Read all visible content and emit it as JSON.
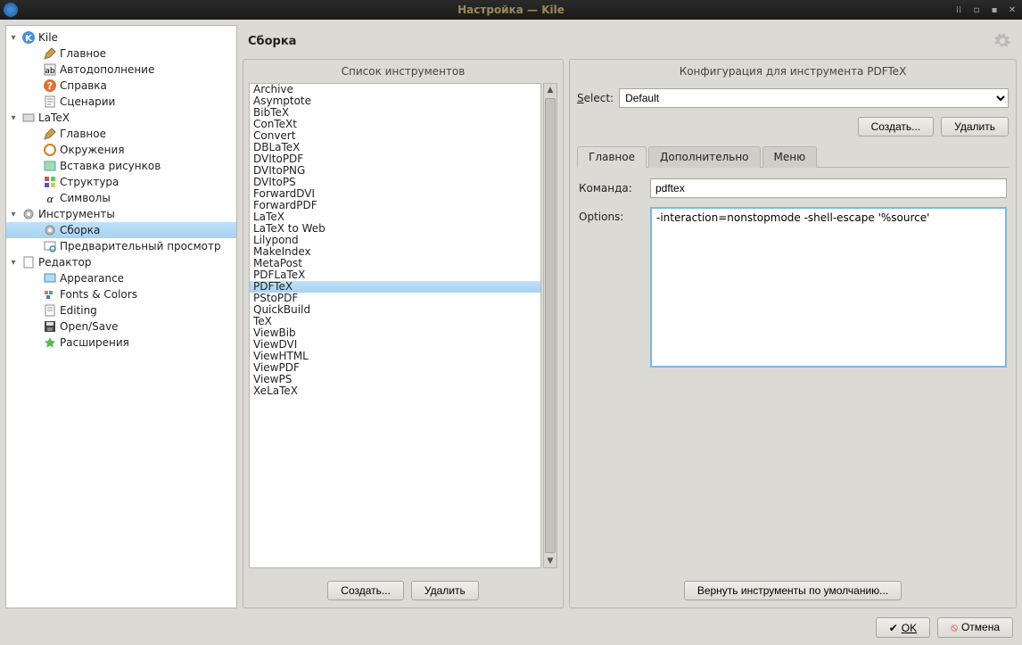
{
  "window": {
    "title": "Настройка — Kile"
  },
  "page": {
    "title": "Сборка"
  },
  "sidebar": {
    "nodes": [
      {
        "label": "Kile",
        "depth": 0,
        "expand": "▾",
        "icon": "app",
        "sel": false
      },
      {
        "label": "Главное",
        "depth": 1,
        "expand": "",
        "icon": "pencil",
        "sel": false
      },
      {
        "label": "Автодополнение",
        "depth": 1,
        "expand": "",
        "icon": "auto",
        "sel": false
      },
      {
        "label": "Справка",
        "depth": 1,
        "expand": "",
        "icon": "help",
        "sel": false
      },
      {
        "label": "Сценарии",
        "depth": 1,
        "expand": "",
        "icon": "script",
        "sel": false
      },
      {
        "label": "LaTeX",
        "depth": 0,
        "expand": "▾",
        "icon": "latex",
        "sel": false
      },
      {
        "label": "Главное",
        "depth": 1,
        "expand": "",
        "icon": "pencil",
        "sel": false
      },
      {
        "label": "Окружения",
        "depth": 1,
        "expand": "",
        "icon": "env",
        "sel": false
      },
      {
        "label": "Вставка рисунков",
        "depth": 1,
        "expand": "",
        "icon": "img",
        "sel": false
      },
      {
        "label": "Структура",
        "depth": 1,
        "expand": "",
        "icon": "struct",
        "sel": false
      },
      {
        "label": "Символы",
        "depth": 1,
        "expand": "",
        "icon": "alpha",
        "sel": false
      },
      {
        "label": "Инструменты",
        "depth": 0,
        "expand": "▾",
        "icon": "gear",
        "sel": false
      },
      {
        "label": "Сборка",
        "depth": 1,
        "expand": "",
        "icon": "gear",
        "sel": true
      },
      {
        "label": "Предварительный просмотр",
        "depth": 1,
        "expand": "",
        "icon": "preview",
        "sel": false
      },
      {
        "label": "Редактор",
        "depth": 0,
        "expand": "▾",
        "icon": "editor",
        "sel": false
      },
      {
        "label": "Appearance",
        "depth": 1,
        "expand": "",
        "icon": "appear",
        "sel": false
      },
      {
        "label": "Fonts & Colors",
        "depth": 1,
        "expand": "",
        "icon": "fonts",
        "sel": false
      },
      {
        "label": "Editing",
        "depth": 1,
        "expand": "",
        "icon": "edit",
        "sel": false
      },
      {
        "label": "Open/Save",
        "depth": 1,
        "expand": "",
        "icon": "save",
        "sel": false
      },
      {
        "label": "Расширения",
        "depth": 1,
        "expand": "",
        "icon": "ext",
        "sel": false
      }
    ]
  },
  "tools": {
    "header": "Список инструментов",
    "items": [
      "Archive",
      "Asymptote",
      "BibTeX",
      "ConTeXt",
      "Convert",
      "DBLaTeX",
      "DVItoPDF",
      "DVItoPNG",
      "DVItoPS",
      "ForwardDVI",
      "ForwardPDF",
      "LaTeX",
      "LaTeX to Web",
      "Lilypond",
      "MakeIndex",
      "MetaPost",
      "PDFLaTeX",
      "PDFTeX",
      "PStoPDF",
      "QuickBuild",
      "TeX",
      "ViewBib",
      "ViewDVI",
      "ViewHTML",
      "ViewPDF",
      "ViewPS",
      "XeLaTeX"
    ],
    "selected": "PDFTeX",
    "create": "Создать...",
    "delete": "Удалить"
  },
  "config": {
    "header": "Конфигурация для инструмента PDFTeX",
    "select_label": "Select:",
    "select_value": "Default",
    "create": "Создать...",
    "delete": "Удалить",
    "tabs": {
      "main": "Главное",
      "advanced": "Дополнительно",
      "menu": "Меню"
    },
    "command_label": "Команда:",
    "command_value": "pdftex",
    "options_label": "Options:",
    "options_value": "-interaction=nonstopmode -shell-escape '%source'",
    "restore": "Вернуть инструменты по умолчанию..."
  },
  "footer": {
    "ok": "OK",
    "cancel": "Отмена"
  }
}
